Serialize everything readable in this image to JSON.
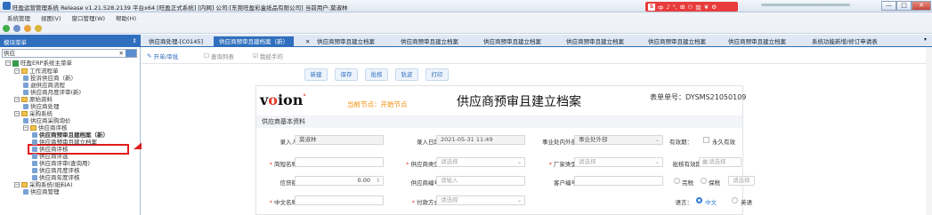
{
  "window": {
    "title": "旺盈运营管理系统 Release v1.21.528.2139 平台x64 [旺盈正式系统] [内网] 公司:[东莞旺盈彩盒纸品有限公司] 当前用户:莫淑林",
    "min": "—",
    "max": "□",
    "close": "✕"
  },
  "ime": {
    "items": [
      "中",
      "♪",
      "°,",
      "⊞",
      "⚇",
      "简",
      "❦",
      "⚙"
    ]
  },
  "menu": [
    "系统管理",
    "视图(V)",
    "窗口管理(W)",
    "帮助(H)"
  ],
  "module_panel": {
    "title": "模块菜单",
    "pin": "⇕"
  },
  "search": {
    "value": "供应",
    "clear": "✕"
  },
  "tree": [
    {
      "label": "旺盈ERP系统主菜单",
      "level": 0,
      "type": "root"
    },
    {
      "label": "工作流程单",
      "level": 1,
      "type": "folder"
    },
    {
      "label": "投诉供应商（新）",
      "level": 2,
      "type": "leaf"
    },
    {
      "label": "退供应商流程",
      "level": 2,
      "type": "leaf"
    },
    {
      "label": "供应商月度评审(新)",
      "level": 2,
      "type": "leaf"
    },
    {
      "label": "原始资料",
      "level": 1,
      "type": "folder"
    },
    {
      "label": "供应商处理",
      "level": 2,
      "type": "leaf"
    },
    {
      "label": "采购系统",
      "level": 1,
      "type": "folder"
    },
    {
      "label": "供应商采购询价",
      "level": 2,
      "type": "leaf"
    },
    {
      "label": "供应商评核",
      "level": 2,
      "type": "folder"
    },
    {
      "label": "供应商预审且建档案（新）",
      "level": 3,
      "type": "leaf"
    },
    {
      "label": "供应商预审且建立档案",
      "level": 3,
      "type": "leaf"
    },
    {
      "label": "供应商评核",
      "level": 3,
      "type": "leaf"
    },
    {
      "label": "供应商评选",
      "level": 3,
      "type": "leaf"
    },
    {
      "label": "供应商评审(查询用)",
      "level": 3,
      "type": "leaf"
    },
    {
      "label": "供应商月度评核",
      "level": 3,
      "type": "leaf"
    },
    {
      "label": "供应商年度评核",
      "level": 3,
      "type": "leaf"
    },
    {
      "label": "采购系统(纸料A)",
      "level": 1,
      "type": "folder"
    },
    {
      "label": "供应商管理",
      "level": 2,
      "type": "leaf"
    }
  ],
  "tabs": [
    "供应商处理-[C0145]",
    "供应商预审且建档案（新）",
    "供应商预审且建立档案",
    "供应商预审且建立档案",
    "供应商预审且建立档案",
    "供应商预审且建立档案",
    "供应商预审且建立档案",
    "供应商预审且建立档案",
    "系统功能新增/修订申请表"
  ],
  "tab_close": "✕",
  "tab_end": "▾",
  "subtabs": [
    "开单/审批",
    "查询列表",
    "我经手的"
  ],
  "subtab_icons": [
    "✎",
    "☐",
    "☑"
  ],
  "toolbar": [
    "新建",
    "保存",
    "批核",
    "轨迹",
    "打印"
  ],
  "form": {
    "logo_prefix": "v",
    "logo_o": "o",
    "logo_suffix": "ion",
    "logo_mark": "°",
    "node_label": "当前节点：开始节点",
    "title": "供应商预审且建立档案",
    "number_label": "表单单号：DYSMS21050109",
    "section": "供应商基本资料",
    "rows": [
      [
        {
          "label": "录入人",
          "value": "莫淑林",
          "disabled": true
        },
        {
          "label": "录入日期",
          "value": "2021-05-31 11:49",
          "disabled": true
        },
        {
          "label": "事业处内外部",
          "value": "事业处外部",
          "disabled": true,
          "select": true
        },
        {
          "label": "有效期：",
          "checkbox": "永久有效"
        }
      ],
      [
        {
          "label": "简短名称",
          "required": true,
          "value": ""
        },
        {
          "label": "供应商类型",
          "required": true,
          "placeholder": "请选择",
          "select": true
        },
        {
          "label": "厂家类型",
          "required": true,
          "placeholder": "请选择",
          "select": true
        },
        {
          "label": "批核有效期",
          "placeholder": "请选择",
          "date": true
        }
      ],
      [
        {
          "label": "信贷额",
          "value": "0.00",
          "stepper": true
        },
        {
          "label": "供应商编号",
          "placeholder": "请输入"
        },
        {
          "label": "客户编号",
          "value": ""
        },
        {
          "radios": [
            "完税",
            "保税"
          ],
          "placeholder": "请选择"
        }
      ],
      [
        {
          "label": "中文名称",
          "required": true,
          "value": ""
        },
        {
          "label": "付款方式",
          "required": true,
          "placeholder": "请选择",
          "select": true
        },
        {
          "label": "语言：",
          "radios2": [
            "中文",
            "英语"
          ],
          "selected": "中文"
        }
      ]
    ]
  }
}
